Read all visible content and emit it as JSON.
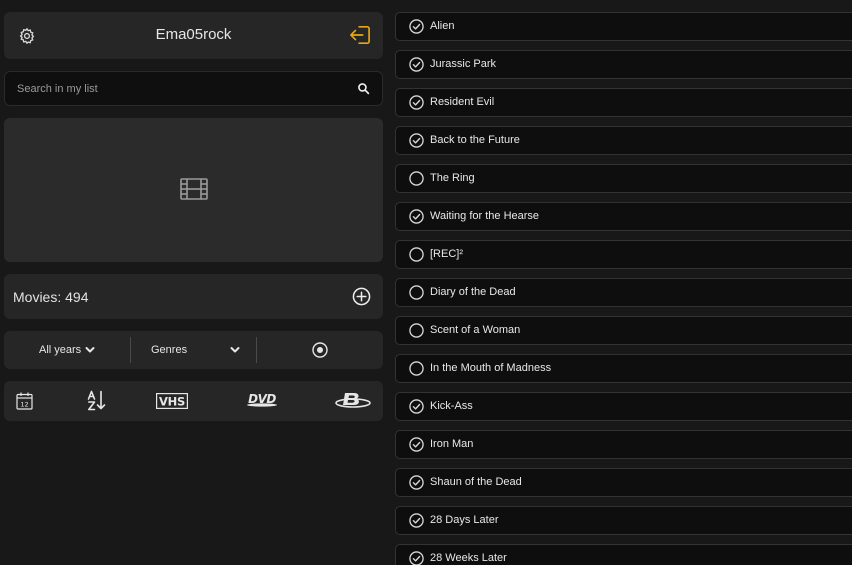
{
  "header": {
    "username": "Ema05rock",
    "settings_icon": "gear-icon",
    "logout_icon": "logout-icon",
    "accent": "#e6a817"
  },
  "search": {
    "placeholder": "Search in my list",
    "value": ""
  },
  "poster": {
    "icon": "film-icon"
  },
  "stats": {
    "movies_label": "Movies:",
    "movies_count": "494"
  },
  "filters": {
    "years": "All years",
    "genres": "Genres"
  },
  "formats": [
    "calendar-icon",
    "sort-az-icon",
    "vhs-logo",
    "dvd-logo",
    "bluray-logo"
  ],
  "movies": [
    {
      "title": "Alien",
      "watched": true
    },
    {
      "title": "Jurassic Park",
      "watched": true
    },
    {
      "title": "Resident Evil",
      "watched": true
    },
    {
      "title": "Back to the Future",
      "watched": true
    },
    {
      "title": "The Ring",
      "watched": false
    },
    {
      "title": "Waiting for the Hearse",
      "watched": true
    },
    {
      "title": "[REC]²",
      "watched": false
    },
    {
      "title": "Diary of the Dead",
      "watched": false
    },
    {
      "title": "Scent of a Woman",
      "watched": false
    },
    {
      "title": "In the Mouth of Madness",
      "watched": false
    },
    {
      "title": "Kick-Ass",
      "watched": true
    },
    {
      "title": "Iron Man",
      "watched": true
    },
    {
      "title": "Shaun of the Dead",
      "watched": true
    },
    {
      "title": "28 Days Later",
      "watched": true
    },
    {
      "title": "28 Weeks Later",
      "watched": true
    }
  ]
}
